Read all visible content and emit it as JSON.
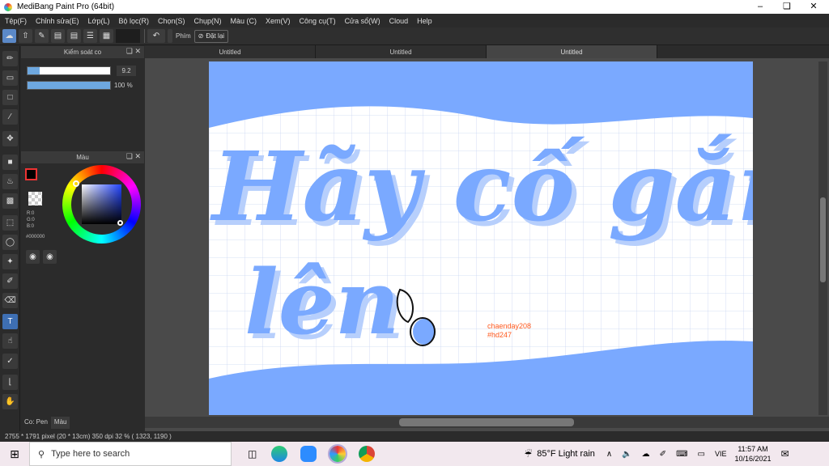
{
  "window": {
    "title": "MediBang Paint Pro (64bit)"
  },
  "menu": [
    "Tệp(F)",
    "Chỉnh sửa(E)",
    "Lớp(L)",
    "Bộ lọc(R)",
    "Chọn(S)",
    "Chụp(N)",
    "Màu (C)",
    "Xem(V)",
    "Công cụ(T)",
    "Cửa sổ(W)",
    "Cloud",
    "Help"
  ],
  "toolbar": {
    "snap_label": "Phím",
    "reset_label": "Đặt lại"
  },
  "brush_panel": {
    "title": "Kiểm soát co",
    "size_value": "9.2",
    "size_fraction": 0.15,
    "opacity_value": "100 %",
    "opacity_fraction": 1.0
  },
  "color_panel": {
    "title": "Màu",
    "r": "R:0",
    "g": "G:0",
    "b": "B:0",
    "hex": "#000000"
  },
  "left_tabs": {
    "brush": "Co: Pen",
    "color": "Màu"
  },
  "tabs": [
    "Untitled",
    "Untitled",
    "Untitled"
  ],
  "canvas": {
    "line1": "Hãy cố gắng",
    "line2": "lên",
    "watermark1": "chaenday208",
    "watermark2": "#hd247",
    "sky_color": "#7aa9ff"
  },
  "status": {
    "size": "2755 * 1791 pixel",
    "dims": "(20 * 13cm)",
    "dpi": "350 dpi",
    "zoom": "32 %",
    "coords": "( 1323, 1190 )"
  },
  "taskbar": {
    "search_placeholder": "Type here to search",
    "weather": "85°F  Light rain",
    "lang": "VIE",
    "time": "11:57 AM",
    "date": "10/16/2021"
  }
}
